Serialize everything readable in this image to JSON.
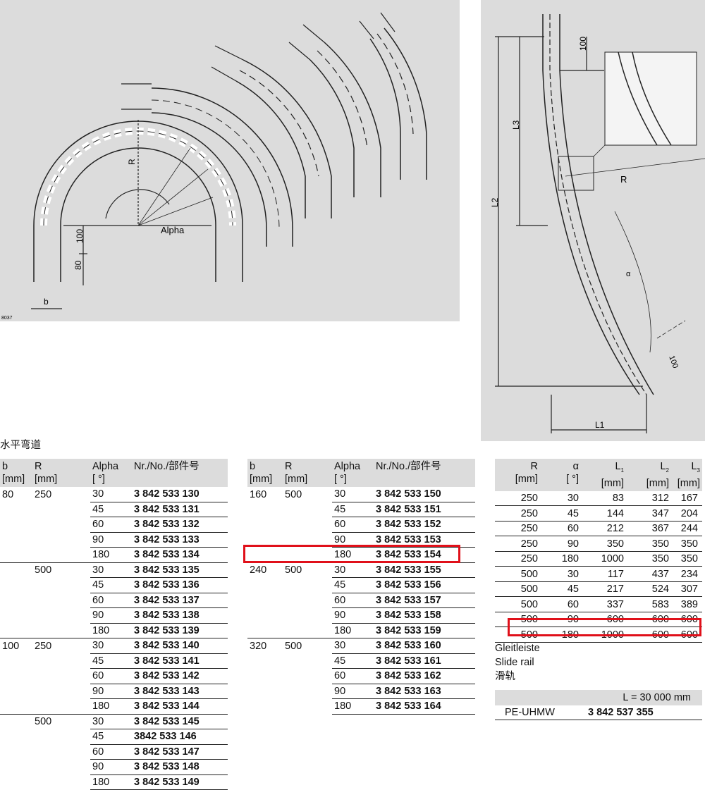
{
  "figure_left": {
    "code": "8037",
    "label_R": "R",
    "label_alpha": "Alpha",
    "label_100": "100",
    "label_80": "80",
    "label_b": "b"
  },
  "figure_right": {
    "label_100_top": "100",
    "label_L3": "L3",
    "label_L2": "L2",
    "label_L1": "L1",
    "label_R": "R",
    "label_alpha": "α",
    "label_100_bottom": "100"
  },
  "section_title": "水平弯道",
  "table1": {
    "headers": {
      "b": "b",
      "b_unit": "[mm]",
      "r": "R",
      "r_unit": "[mm]",
      "alpha": "Alpha",
      "alpha_unit": "[ °]",
      "nr": "Nr./No./部件号"
    },
    "rows": [
      {
        "b": "80",
        "r": "250",
        "alpha": "30",
        "nr": "3 842 533 130"
      },
      {
        "b": "",
        "r": "",
        "alpha": "45",
        "nr": "3 842 533 131"
      },
      {
        "b": "",
        "r": "",
        "alpha": "60",
        "nr": "3 842 533 132"
      },
      {
        "b": "",
        "r": "",
        "alpha": "90",
        "nr": "3 842 533 133"
      },
      {
        "b": "",
        "r": "",
        "alpha": "180",
        "nr": "3 842 533 134"
      },
      {
        "b": "",
        "r": "500",
        "alpha": "30",
        "nr": "3 842 533 135"
      },
      {
        "b": "",
        "r": "",
        "alpha": "45",
        "nr": "3 842 533 136"
      },
      {
        "b": "",
        "r": "",
        "alpha": "60",
        "nr": "3 842 533 137"
      },
      {
        "b": "",
        "r": "",
        "alpha": "90",
        "nr": "3 842 533 138"
      },
      {
        "b": "",
        "r": "",
        "alpha": "180",
        "nr": "3 842 533 139"
      },
      {
        "b": "100",
        "r": "250",
        "alpha": "30",
        "nr": "3 842 533 140"
      },
      {
        "b": "",
        "r": "",
        "alpha": "45",
        "nr": "3 842 533 141"
      },
      {
        "b": "",
        "r": "",
        "alpha": "60",
        "nr": "3 842 533 142"
      },
      {
        "b": "",
        "r": "",
        "alpha": "90",
        "nr": "3 842 533 143"
      },
      {
        "b": "",
        "r": "",
        "alpha": "180",
        "nr": "3 842 533 144"
      },
      {
        "b": "",
        "r": "500",
        "alpha": "30",
        "nr": "3 842 533 145"
      },
      {
        "b": "",
        "r": "",
        "alpha": "45",
        "nr": "3842 533 146"
      },
      {
        "b": "",
        "r": "",
        "alpha": "60",
        "nr": "3 842 533 147"
      },
      {
        "b": "",
        "r": "",
        "alpha": "90",
        "nr": "3 842 533 148"
      },
      {
        "b": "",
        "r": "",
        "alpha": "180",
        "nr": "3 842 533 149"
      }
    ]
  },
  "table2": {
    "headers": {
      "b": "b",
      "b_unit": "[mm]",
      "r": "R",
      "r_unit": "[mm]",
      "alpha": "Alpha",
      "alpha_unit": "[ °]",
      "nr": "Nr./No./部件号"
    },
    "rows": [
      {
        "b": "160",
        "r": "500",
        "alpha": "30",
        "nr": "3 842 533 150"
      },
      {
        "b": "",
        "r": "",
        "alpha": "45",
        "nr": "3 842 533 151"
      },
      {
        "b": "",
        "r": "",
        "alpha": "60",
        "nr": "3 842 533 152"
      },
      {
        "b": "",
        "r": "",
        "alpha": "90",
        "nr": "3 842 533 153"
      },
      {
        "b": "",
        "r": "",
        "alpha": "180",
        "nr": "3 842 533 154"
      },
      {
        "b": "240",
        "r": "500",
        "alpha": "30",
        "nr": "3 842 533 155"
      },
      {
        "b": "",
        "r": "",
        "alpha": "45",
        "nr": "3 842 533 156"
      },
      {
        "b": "",
        "r": "",
        "alpha": "60",
        "nr": "3 842 533 157"
      },
      {
        "b": "",
        "r": "",
        "alpha": "90",
        "nr": "3 842 533 158"
      },
      {
        "b": "",
        "r": "",
        "alpha": "180",
        "nr": "3 842 533 159"
      },
      {
        "b": "320",
        "r": "500",
        "alpha": "30",
        "nr": "3 842 533 160"
      },
      {
        "b": "",
        "r": "",
        "alpha": "45",
        "nr": "3 842 533 161"
      },
      {
        "b": "",
        "r": "",
        "alpha": "60",
        "nr": "3 842 533 162"
      },
      {
        "b": "",
        "r": "",
        "alpha": "90",
        "nr": "3 842 533 163"
      },
      {
        "b": "",
        "r": "",
        "alpha": "180",
        "nr": "3 842 533 164"
      }
    ]
  },
  "table3": {
    "headers": {
      "r": "R",
      "r_unit": "[mm]",
      "alpha": "α",
      "alpha_unit": "[ °]",
      "l1": "L",
      "l1_sub": "1",
      "l1_unit": "[mm]",
      "l2": "L",
      "l2_sub": "2",
      "l2_unit": "[mm]",
      "l3": "L",
      "l3_sub": "3",
      "l3_unit": "[mm]"
    },
    "rows": [
      {
        "r": "250",
        "alpha": "30",
        "l1": "83",
        "l2": "312",
        "l3": "167"
      },
      {
        "r": "250",
        "alpha": "45",
        "l1": "144",
        "l2": "347",
        "l3": "204"
      },
      {
        "r": "250",
        "alpha": "60",
        "l1": "212",
        "l2": "367",
        "l3": "244"
      },
      {
        "r": "250",
        "alpha": "90",
        "l1": "350",
        "l2": "350",
        "l3": "350"
      },
      {
        "r": "250",
        "alpha": "180",
        "l1": "1000",
        "l2": "350",
        "l3": "350"
      },
      {
        "r": "500",
        "alpha": "30",
        "l1": "117",
        "l2": "437",
        "l3": "234"
      },
      {
        "r": "500",
        "alpha": "45",
        "l1": "217",
        "l2": "524",
        "l3": "307"
      },
      {
        "r": "500",
        "alpha": "60",
        "l1": "337",
        "l2": "583",
        "l3": "389"
      },
      {
        "r": "500",
        "alpha": "90",
        "l1": "600",
        "l2": "600",
        "l3": "600"
      },
      {
        "r": "500",
        "alpha": "180",
        "l1": "1000",
        "l2": "600",
        "l3": "600"
      }
    ]
  },
  "slide_rail": {
    "title_de": "Gleitleiste",
    "title_en": "Slide rail",
    "title_zh": "滑轨",
    "length_label": "L = 30 000 mm",
    "material": "PE-UHMW",
    "nr": "3 842 537 355"
  },
  "highlight_color": "#e0101a"
}
